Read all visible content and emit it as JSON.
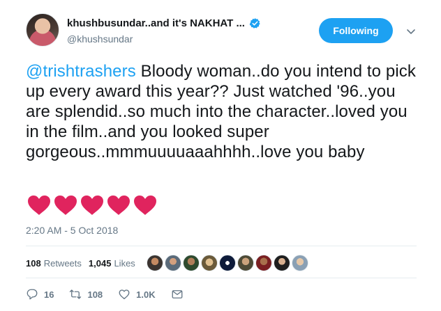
{
  "author": {
    "display_name": "khushbusundar..and it's NAKHAT ...",
    "handle": "@khushsundar"
  },
  "header": {
    "follow_label": "Following"
  },
  "tweet": {
    "mention": "@trishtrashers",
    "body": " Bloody woman..do you intend to pick up every award this year?? Just watched '96..you are splendid..so much into the character..loved you in the film..and you looked super gorgeous..mmmuuuuaaahhhh..love you baby"
  },
  "timestamp": "2:20 AM - 5 Oct 2018",
  "stats": {
    "retweets_count": "108",
    "retweets_label": "Retweets",
    "likes_count": "1,045",
    "likes_label": "Likes"
  },
  "actions": {
    "reply_count": "16",
    "retweet_count": "108",
    "like_count": "1.0K"
  },
  "colors": {
    "accent": "#1da1f2",
    "heart": "#e0245e",
    "muted": "#657786"
  },
  "icons": [
    "verified-icon",
    "chevron-down-icon",
    "heart-emoji",
    "reply-icon",
    "retweet-icon",
    "like-icon",
    "message-icon"
  ]
}
